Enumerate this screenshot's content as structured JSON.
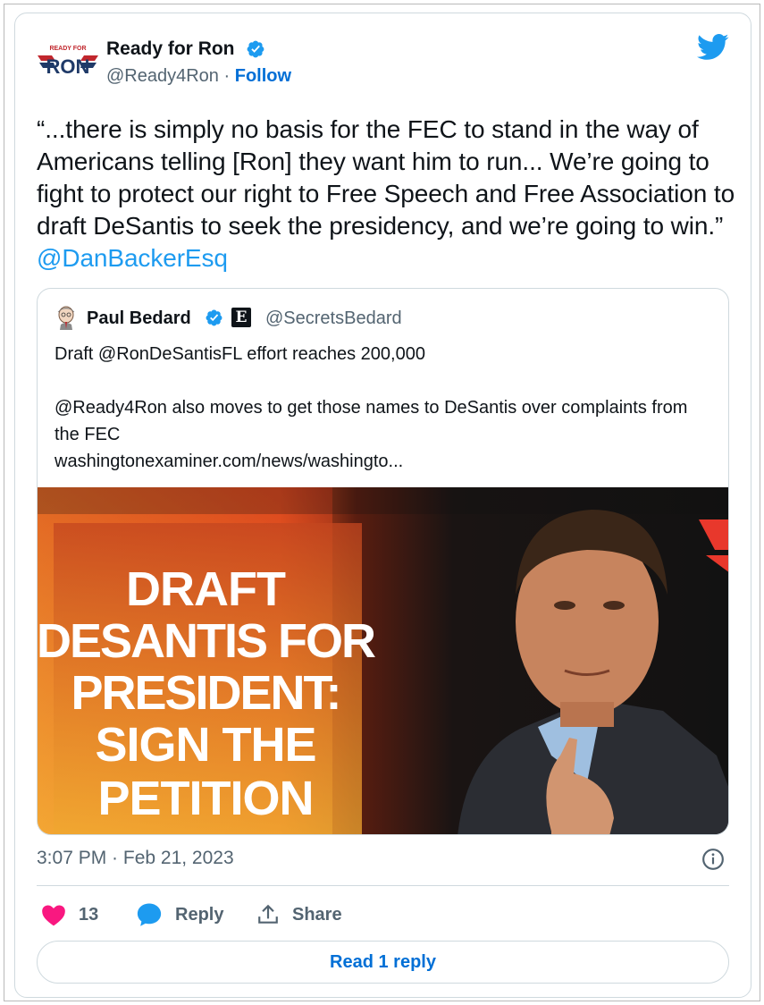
{
  "author": {
    "name": "Ready for Ron",
    "handle": "@Ready4Ron",
    "separator": "·",
    "follow_label": "Follow",
    "logo_text_top": "READY FOR",
    "logo_text_main": "RON"
  },
  "tweet": {
    "text": "“...there is simply no basis for the FEC to stand in the way of Americans telling [Ron] they want him to run... We’re going to fight to protect our right to Free Speech and Free Association to draft DeSantis to seek the presidency, and we’re going to win.” ",
    "mention": "@DanBackerEsq"
  },
  "quote": {
    "name": "Paul Bedard",
    "publisher_glyph": "E",
    "handle": "@SecretsBedard",
    "line1": "Draft @RonDeSantisFL effort reaches 200,000",
    "line2": "@Ready4Ron also moves to get those names to DeSantis over complaints from the FEC",
    "link": "washingtonexaminer.com/news/washingto...",
    "image_headline": [
      "DRAFT",
      "DESANTIS FOR",
      "PRESIDENT:",
      "SIGN THE",
      "PETITION"
    ]
  },
  "footer": {
    "timestamp": "3:07 PM · Feb 21, 2023",
    "like_count": "13",
    "reply_label": "Reply",
    "share_label": "Share",
    "read_replies_label": "Read 1 reply"
  },
  "colors": {
    "link_blue": "#1d9bf0",
    "follow_blue": "#006fd6",
    "like_pink": "#f91880",
    "text_gray": "#536471"
  }
}
